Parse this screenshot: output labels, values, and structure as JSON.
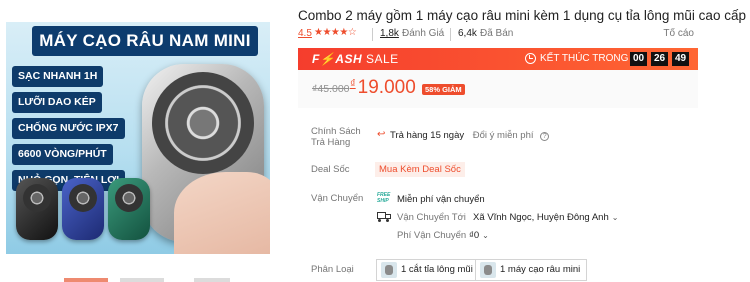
{
  "product": {
    "title": "Combo 2 máy gồm 1 máy cạo râu mini kèm 1 dụng cụ tỉa lông mũi cao cấp",
    "image": {
      "heading": "MÁY CẠO RÂU NAM MINI",
      "features": [
        "SẠC NHANH 1H",
        "LƯỠI DAO KÉP",
        "CHỐNG NƯỚC IPX7",
        "6600 VÒNG/PHÚT",
        "NHỎ GỌN, TIỆN LỢI"
      ]
    }
  },
  "rating": {
    "score": "4.5",
    "stars_value": 4.5,
    "star_glyphs": "★★★★☆",
    "review_count": "1,8k",
    "review_label": "Đánh Giá",
    "sold_count": "6,4k",
    "sold_label": "Đã Bán",
    "report_label": "Tố cáo"
  },
  "flash_sale": {
    "logo_left": "F⚡ASH",
    "logo_right": "SALE",
    "ends_label": "KẾT THÚC TRONG",
    "timer": [
      "00",
      "26",
      "49"
    ]
  },
  "price": {
    "original": "₫45.000",
    "currency": "₫",
    "current": "19.000",
    "discount_badge": "58% GIẢM"
  },
  "details": {
    "return_policy": {
      "label": "Chính Sách Trả Hàng",
      "value": "Trả hàng 15 ngày",
      "note": "Đổi ý miễn phí",
      "help": "?"
    },
    "deal": {
      "label": "Deal Sốc",
      "value": "Mua Kèm Deal Sốc"
    },
    "shipping": {
      "label": "Vận Chuyển",
      "free_label": "Miễn phí vận chuyển",
      "free_icon_text": "FREE SHIP",
      "to_label": "Vận Chuyển Tới",
      "to_value": "Xã Vĩnh Ngọc, Huyện Đông Anh",
      "fee_label": "Phí Vận Chuyển",
      "fee_value": "₫0"
    },
    "variation": {
      "label": "Phân Loại",
      "options": [
        "1 cắt tỉa lông mũi",
        "1 máy cạo râu mini"
      ]
    }
  },
  "colors": {
    "accent": "#ee4d2d",
    "flash_bg": "#f53d2d",
    "image_banner": "#0e3b6a"
  }
}
